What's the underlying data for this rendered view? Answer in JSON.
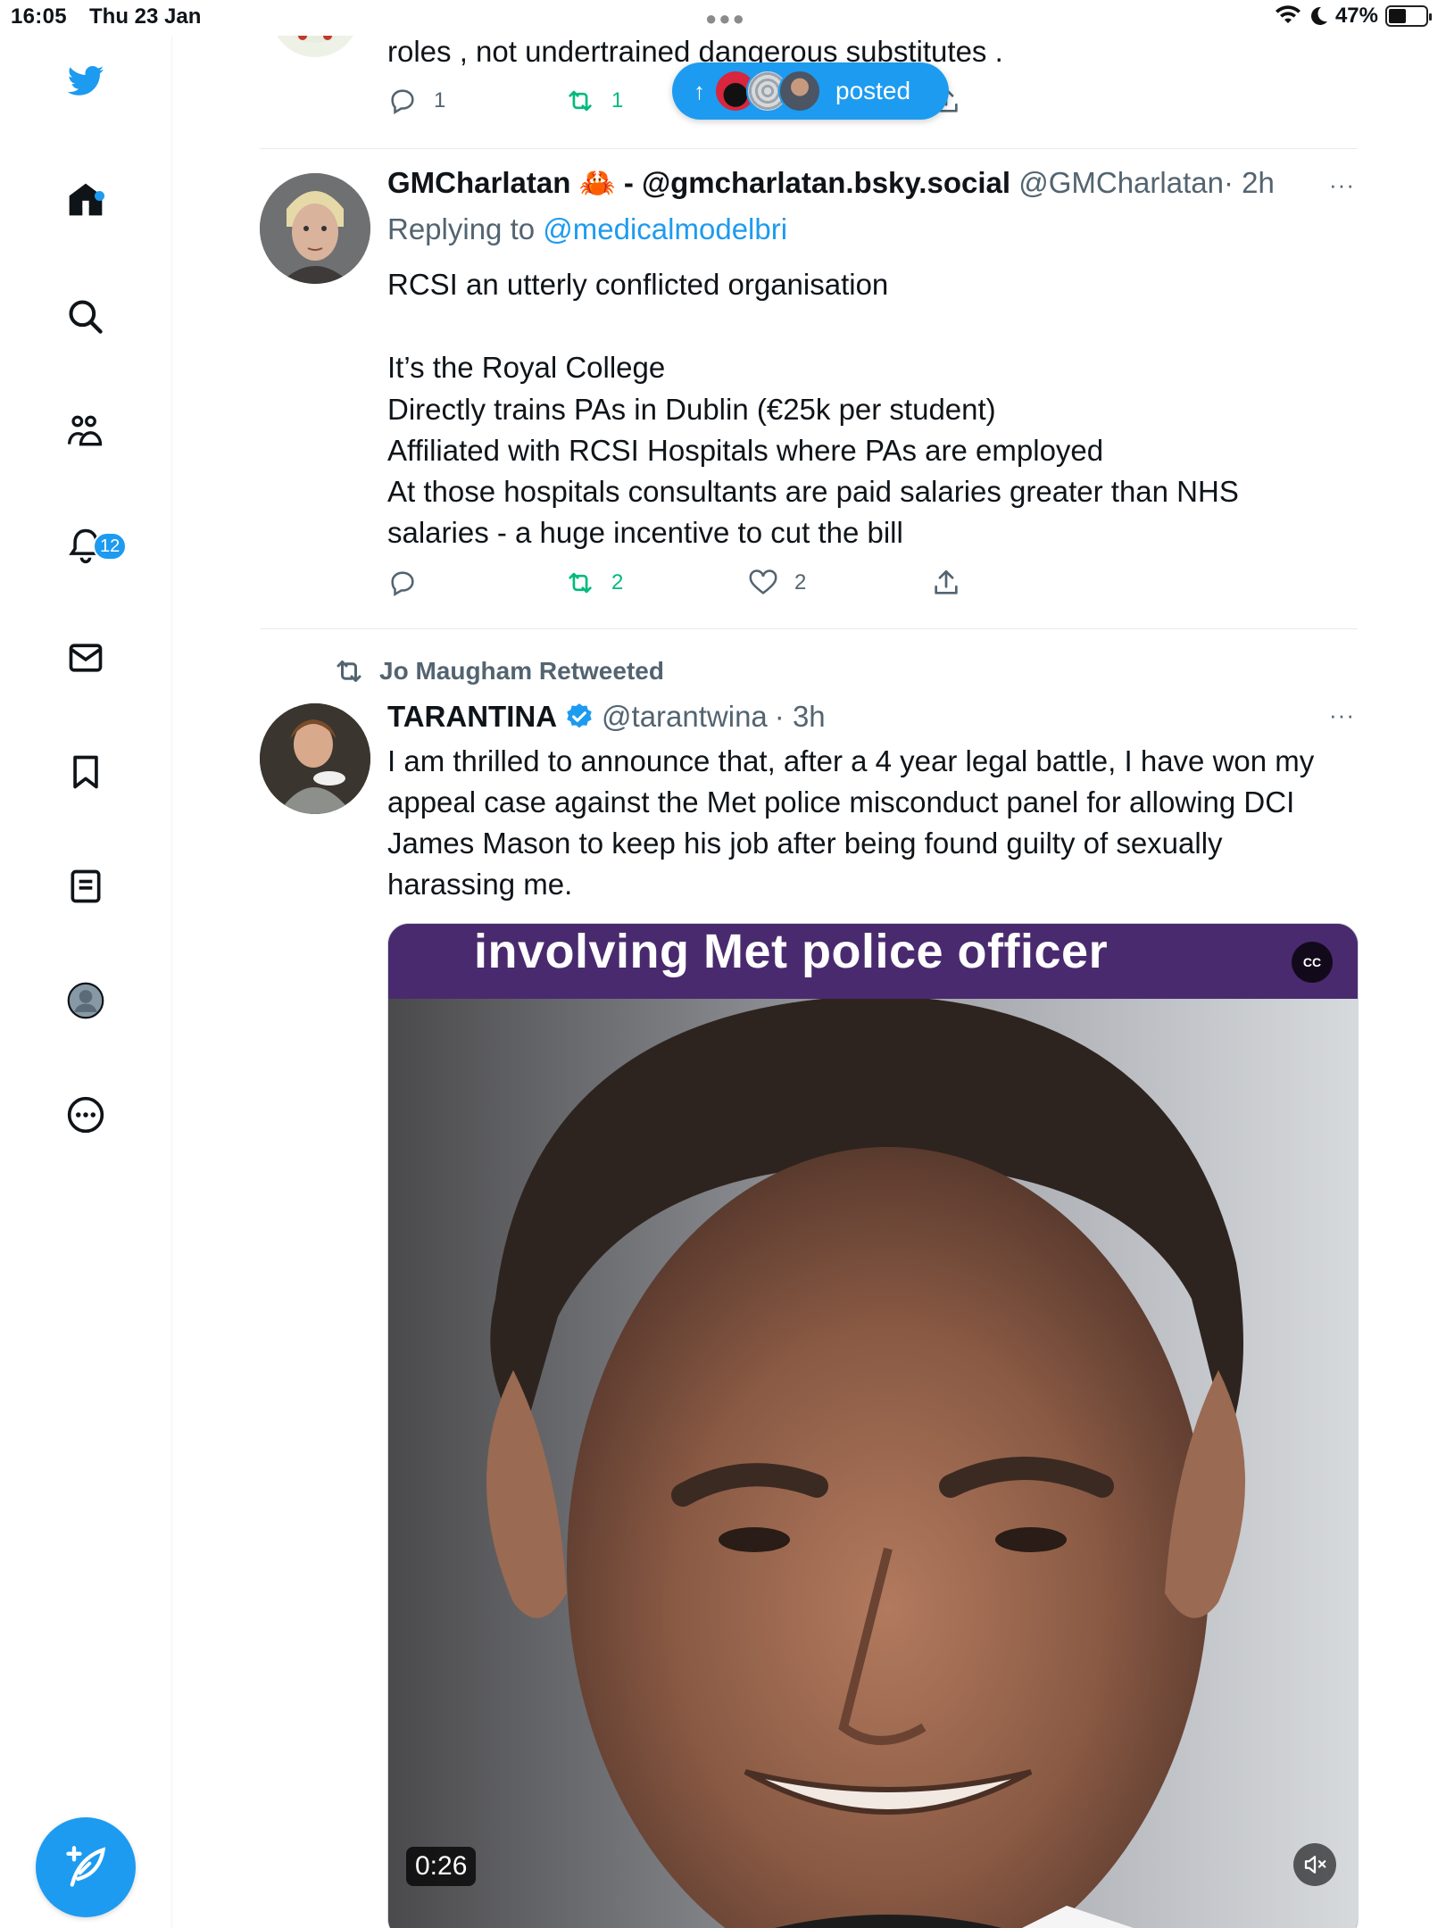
{
  "status_bar": {
    "time": "16:05",
    "date": "Thu 23 Jan",
    "battery": "47%",
    "battery_fraction": 0.47
  },
  "sidebar": {
    "notification_count": "12",
    "items": [
      {
        "icon": "twitter-bird-icon"
      },
      {
        "icon": "home-icon"
      },
      {
        "icon": "search-icon"
      },
      {
        "icon": "communities-icon"
      },
      {
        "icon": "bell-icon"
      },
      {
        "icon": "mail-icon"
      },
      {
        "icon": "bookmark-icon"
      },
      {
        "icon": "lists-icon"
      },
      {
        "icon": "profile-icon"
      },
      {
        "icon": "more-icon"
      }
    ],
    "compose_icon": "feather-plus-icon"
  },
  "new_posts_pill": {
    "label": "posted"
  },
  "tweet_top": {
    "text_fragment": "roles , not undertrained dangerous substitutes .",
    "reply_count": "1",
    "retweet_count": "1"
  },
  "tweet_gm": {
    "display_name": "GMCharlatan",
    "name_suffix": "- @gmcharlatan.bsky.social",
    "handle": "@GMCharlatan",
    "time": "· 2h",
    "replying_prefix": "Replying to",
    "replying_handle": "@medicalmodelbri",
    "lines": [
      "RCSI an utterly conflicted organisation",
      "",
      "It’s the Royal College",
      "Directly trains PAs in Dublin (€25k per student)",
      "Affiliated with RCSI Hospitals where PAs are employed",
      "At those hospitals consultants are paid salaries greater than NHS",
      "salaries - a huge incentive to cut the bill"
    ],
    "retweet_count": "2",
    "like_count": "2"
  },
  "tweet_tarantina": {
    "retweeted_by": "Jo Maugham Retweeted",
    "display_name": "TARANTINA",
    "handle": "@tarantwina",
    "time": "· 3h",
    "lines": [
      "I am thrilled to announce that, after a 4 year legal battle, I have won my",
      "appeal case against the Met police misconduct panel for allowing DCI",
      "James Mason to keep his job after being found guilty of sexually",
      "harassing me."
    ],
    "video": {
      "caption": "involving Met police officer",
      "duration": "0:26",
      "cc_label": "CC"
    }
  }
}
